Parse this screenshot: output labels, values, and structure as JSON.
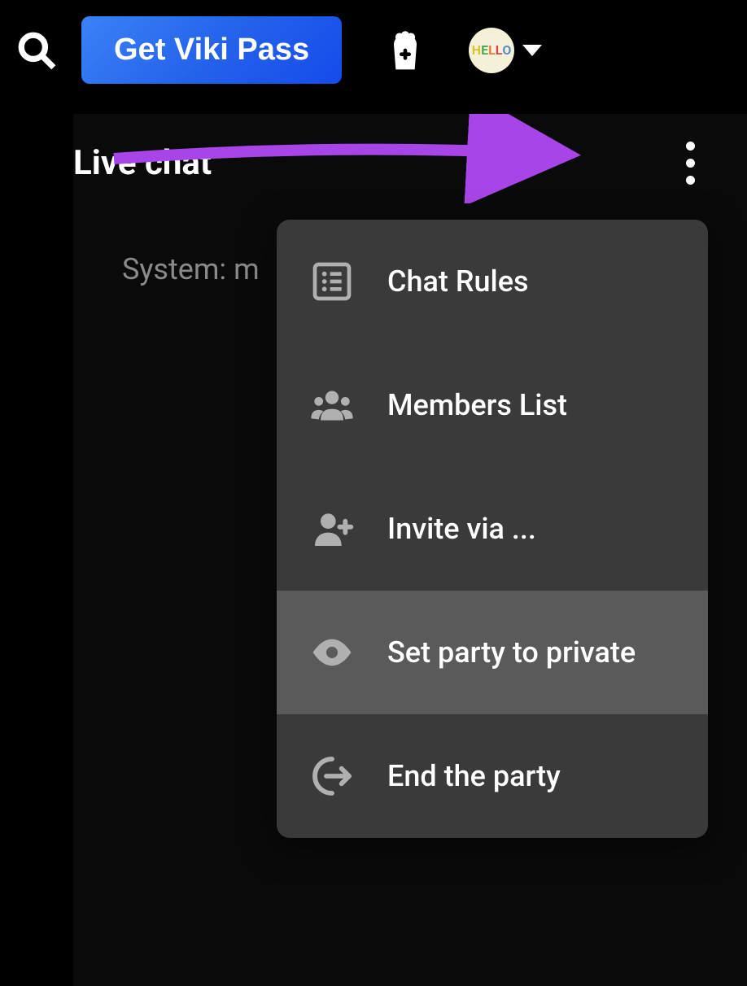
{
  "topbar": {
    "get_pass_label": "Get Viki Pass",
    "avatar_text": "HELLO"
  },
  "chat": {
    "title": "Live chat",
    "system_msg_prefix": "System: m"
  },
  "menu": {
    "items": [
      {
        "label": "Chat Rules",
        "highlighted": false
      },
      {
        "label": "Members List",
        "highlighted": false
      },
      {
        "label": "Invite via ...",
        "highlighted": false
      },
      {
        "label": "Set party to private",
        "highlighted": true
      },
      {
        "label": "End the party",
        "highlighted": false
      }
    ]
  }
}
